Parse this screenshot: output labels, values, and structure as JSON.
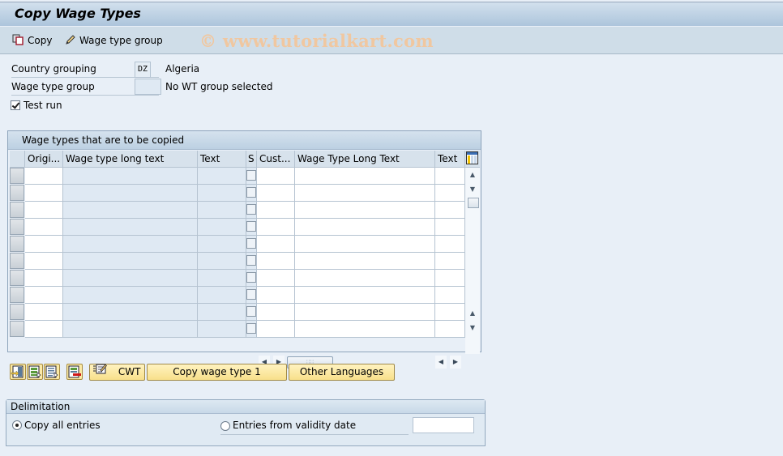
{
  "window": {
    "title": "Copy Wage Types",
    "watermark": "© www.tutorialkart.com"
  },
  "toolbar": {
    "copy_label": "Copy",
    "wage_type_group_label": "Wage type group"
  },
  "form": {
    "country_grouping": {
      "label": "Country grouping",
      "value": "DZ",
      "description": "Algeria"
    },
    "wage_type_group": {
      "label": "Wage type group",
      "value": "",
      "description": "No WT group selected"
    },
    "test_run": {
      "label": "Test run",
      "checked": true
    }
  },
  "table": {
    "title": "Wage types that are to be copied",
    "columns": [
      "Origi...",
      "Wage type long text",
      "Text",
      "S",
      "Cust...",
      "Wage Type Long Text",
      "Text"
    ],
    "row_count": 10,
    "rows": [
      [
        "",
        "",
        "",
        "",
        "",
        "",
        ""
      ],
      [
        "",
        "",
        "",
        "",
        "",
        "",
        ""
      ],
      [
        "",
        "",
        "",
        "",
        "",
        "",
        ""
      ],
      [
        "",
        "",
        "",
        "",
        "",
        "",
        ""
      ],
      [
        "",
        "",
        "",
        "",
        "",
        "",
        ""
      ],
      [
        "",
        "",
        "",
        "",
        "",
        "",
        ""
      ],
      [
        "",
        "",
        "",
        "",
        "",
        "",
        ""
      ],
      [
        "",
        "",
        "",
        "",
        "",
        "",
        ""
      ],
      [
        "",
        "",
        "",
        "",
        "",
        "",
        ""
      ],
      [
        "",
        "",
        "",
        "",
        "",
        "",
        ""
      ]
    ]
  },
  "buttons": {
    "icon_buttons": [
      "select-all-icon",
      "select-block-icon",
      "deselect-block-icon",
      "deselect-all-icon"
    ],
    "cwt_label": "CWT",
    "copy_wage_type_label": "Copy wage type 1",
    "other_languages_label": "Other Languages"
  },
  "delimitation": {
    "title": "Delimitation",
    "option_all": "Copy all entries",
    "option_from_date": "Entries from validity date",
    "selected": "option_all",
    "validity_date": ""
  }
}
